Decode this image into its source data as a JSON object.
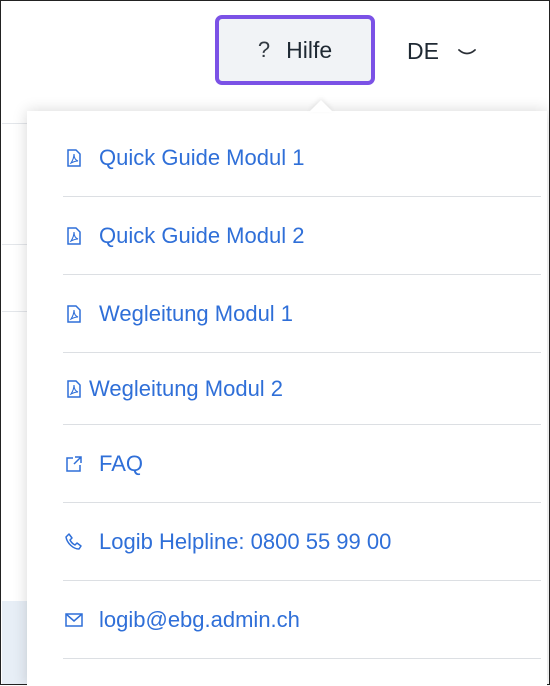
{
  "header": {
    "help_icon": "?",
    "help_label": "Hilfe",
    "language": "DE",
    "language_chevron_icon": "chevron-down-icon",
    "accent_color": "#7b52e6"
  },
  "help_menu": {
    "link_color": "#2f6fd8",
    "items": [
      {
        "icon": "pdf-file-icon",
        "label": "Quick Guide Modul 1"
      },
      {
        "icon": "pdf-file-icon",
        "label": "Quick Guide Modul 2"
      },
      {
        "icon": "pdf-file-icon",
        "label": "Wegleitung Modul 1"
      },
      {
        "icon": "pdf-file-icon",
        "label": "Wegleitung Modul 2"
      },
      {
        "icon": "external-link-icon",
        "label": "FAQ"
      },
      {
        "icon": "phone-icon",
        "label": "Logib Helpline: 0800 55 99 00"
      },
      {
        "icon": "mail-icon",
        "label": "logib@ebg.admin.ch"
      }
    ]
  }
}
